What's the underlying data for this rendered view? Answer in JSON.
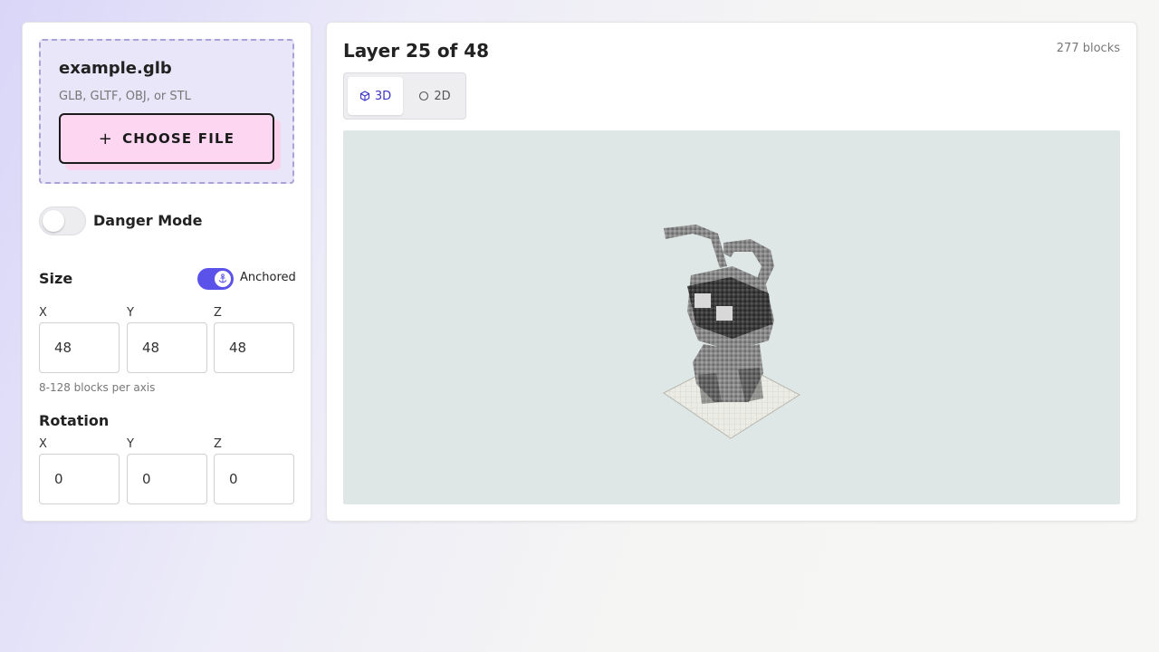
{
  "upload": {
    "filename": "example.glb",
    "hint": "GLB, GLTF, OBJ, or STL",
    "choose_label": "CHOOSE FILE",
    "plus_glyph": "+"
  },
  "danger": {
    "label": "Danger Mode",
    "enabled": false
  },
  "size": {
    "title": "Size",
    "anchored_label": "Anchored",
    "anchored": true,
    "axes": [
      {
        "label": "X",
        "value": "48"
      },
      {
        "label": "Y",
        "value": "48"
      },
      {
        "label": "Z",
        "value": "48"
      }
    ],
    "help": "8-128 blocks per axis"
  },
  "rotation": {
    "title": "Rotation",
    "axes": [
      {
        "label": "X",
        "value": "0"
      },
      {
        "label": "Y",
        "value": "0"
      },
      {
        "label": "Z",
        "value": "0"
      }
    ]
  },
  "viewer": {
    "layer_title": "Layer 25 of 48",
    "block_count": "277 blocks",
    "tabs": [
      {
        "label": "3D",
        "icon": "cube-icon",
        "active": true
      },
      {
        "label": "2D",
        "icon": "circle-icon",
        "active": false
      }
    ],
    "model": "voxel-robot-figure"
  },
  "colors": {
    "accent": "#5b52ea",
    "button_pink": "#fdd6f1",
    "upload_bg": "#e8e6f8",
    "viewport_bg": "#dfe7e6"
  }
}
